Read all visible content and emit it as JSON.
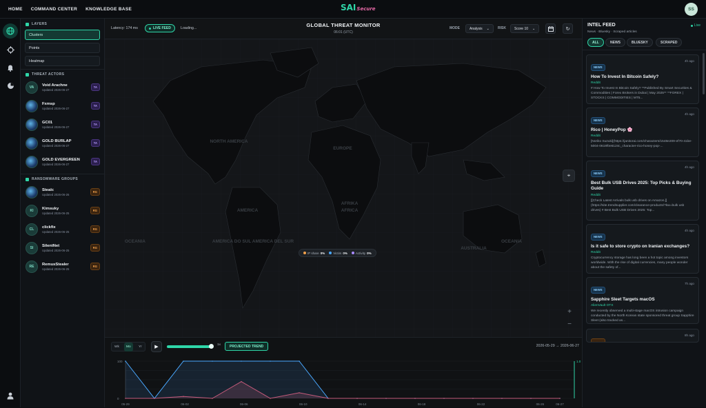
{
  "topnav": [
    "HOME",
    "COMMAND CENTER",
    "KNOWLEDGE BASE"
  ],
  "logo": {
    "main": "SAI",
    "sub": "Secure"
  },
  "user_initials": "SS",
  "rail_icons": [
    "globe-icon",
    "crosshair-icon",
    "bell-icon",
    "chart-pie-icon",
    "user-icon"
  ],
  "layers": {
    "title": "LAYERS",
    "items": [
      "Clusters",
      "Points",
      "Heatmap"
    ],
    "selected": "Clusters"
  },
  "threat_actors": {
    "title": "THREAT ACTORS",
    "items": [
      {
        "initials": "VA",
        "name": "Void Arachne",
        "updated": "Updated 2026-06-27",
        "tag": "TA",
        "image": false
      },
      {
        "initials": "",
        "name": "Fxmsp",
        "updated": "Updated 2026-06-27",
        "tag": "TA",
        "image": true
      },
      {
        "initials": "",
        "name": "GC01",
        "updated": "Updated 2026-06-27",
        "tag": "TA",
        "image": true
      },
      {
        "initials": "",
        "name": "GOLD BURLAP",
        "updated": "Updated 2026-06-27",
        "tag": "TA",
        "image": true
      },
      {
        "initials": "",
        "name": "GOLD EVERGREEN",
        "updated": "Updated 2026-06-27",
        "tag": "TA",
        "image": true
      }
    ]
  },
  "ransomware_groups": {
    "title": "RANSOMWARE GROUPS",
    "items": [
      {
        "initials": "",
        "name": "Stealc",
        "updated": "Updated 2026-06-26",
        "tag": "RG",
        "image": true
      },
      {
        "initials": "KI",
        "name": "Kimsuky",
        "updated": "Updated 2026-06-25",
        "tag": "RG",
        "image": false
      },
      {
        "initials": "CL",
        "name": "clickfix",
        "updated": "Updated 2026-06-25",
        "tag": "RG",
        "image": false
      },
      {
        "initials": "SI",
        "name": "SilentNet",
        "updated": "Updated 2026-06-25",
        "tag": "RG",
        "image": false
      },
      {
        "initials": "RE",
        "name": "RemusStealer",
        "updated": "Updated 2026-06-25",
        "tag": "RG",
        "image": false
      }
    ]
  },
  "monitor": {
    "latency": "Latency: 174 ms",
    "live_label": "LIVE FEED",
    "loading": "Loading...",
    "title": "GLOBAL THREAT MONITOR",
    "time": "06:01 (UTC)",
    "mode_label": "MODE",
    "mode_value": "Analysis",
    "risk_label": "RISK",
    "risk_value": "Score 10",
    "continent_labels": [
      "NORTH AMERICA",
      "EUROPE",
      "AFRIKA",
      "AFRICA",
      "AMERICA",
      "AMERICA DO SUL AMERICA DEL SUR",
      "AUSTRALIA",
      "OCEANIA",
      "OCEANIA"
    ],
    "legend": [
      {
        "label": "IP share",
        "value": "0%",
        "color": "#f0a04b"
      },
      {
        "label": "Victim",
        "value": "0%",
        "color": "#4aa8ff"
      },
      {
        "label": "Activity",
        "value": "0%",
        "color": "#a98bff"
      }
    ]
  },
  "timeline": {
    "segments": [
      "Wk",
      "Mo",
      "Yr"
    ],
    "selected_segment": "Mo",
    "speed": "1x",
    "projected_label": "PROJECTED TREND",
    "range": "2026-05-29 → 2026-06-27",
    "y_ticks": [
      "100",
      "0"
    ],
    "x_ticks": [
      "05-29",
      "06-02",
      "06-06",
      "06-10",
      "06-14",
      "06-18",
      "06-22",
      "06-26",
      "06-27"
    ],
    "right_label": "1.0"
  },
  "chart_data": {
    "type": "area",
    "x": [
      "05-29",
      "05-31",
      "06-02",
      "06-04",
      "06-06",
      "06-08",
      "06-10",
      "06-12",
      "06-14",
      "06-16",
      "06-18",
      "06-20",
      "06-22",
      "06-24",
      "06-26",
      "06-27"
    ],
    "series": [
      {
        "values": [
          100,
          0,
          100,
          100,
          100,
          100,
          100,
          0,
          0,
          0,
          0,
          0,
          0,
          0,
          0,
          0
        ],
        "color": "#4aa8ff"
      },
      {
        "values": [
          0,
          0,
          5,
          0,
          45,
          0,
          15,
          0,
          0,
          0,
          0,
          0,
          0,
          0,
          0,
          0
        ],
        "color": "#c45a7a"
      }
    ],
    "ylim": [
      0,
      100
    ]
  },
  "feed": {
    "title": "INTEL FEED",
    "live": "Live",
    "subtitle": "News · Bluesky · Scraped articles",
    "filters": [
      "ALL",
      "NEWS",
      "BLUESKY",
      "SCRAPED"
    ],
    "selected_filter": "ALL",
    "cards": [
      {
        "badge": "NEWS",
        "ago": "4h ago",
        "title": "How To Invest In Bitcoin Safely?",
        "source": "Reddit",
        "body": "# How To Invest In Bitcoin Safely? **Published By Smart Securities & Commodities | Forex Brokers in Dubai | May 2025** **FOREX | STOCKS | COMMODITIES | MT5..."
      },
      {
        "badge": "NEWS",
        "ago": "4h ago",
        "title": "Rico | HoneyPop 🌸",
        "source": "Reddit",
        "body": "[Noriko Suzuki](https://janitorai.com/characters/1548e209-ef70-41be-5004-0619f0e6124c_character-rico-honey-pop-..."
      },
      {
        "badge": "NEWS",
        "ago": "4h ago",
        "title": "Best Bulk USB Drives 2025: Top Picks & Buying Guide",
        "source": "Reddit",
        "body": "[[Check Latest Arrivals bulk usb drives on Amazon.]](https://site.trendsupplier.com/clearance-products/?kw=bulk usb drives) # Best Bulk USB Drives 2025: Top..."
      },
      {
        "badge": "NEWS",
        "ago": "4h ago",
        "title": "Is it safe to store crypto on Iranian exchanges?",
        "source": "Reddit",
        "body": "Cryptocurrency storage has long been a hot topic among investors worldwide. With the rise of digital currencies, many people wonder about the safety of..."
      },
      {
        "badge": "NEWS",
        "ago": "7h ago",
        "title": "Sapphire Sleet Targets macOS",
        "source": "AlienVault OTX",
        "body": "We recently observed a multi-stage macOS intrusion campaign conducted by the North Korean state sponsored threat group Sapphire Sleet (also tracked as..."
      }
    ],
    "partial_ago": "8h ago"
  }
}
